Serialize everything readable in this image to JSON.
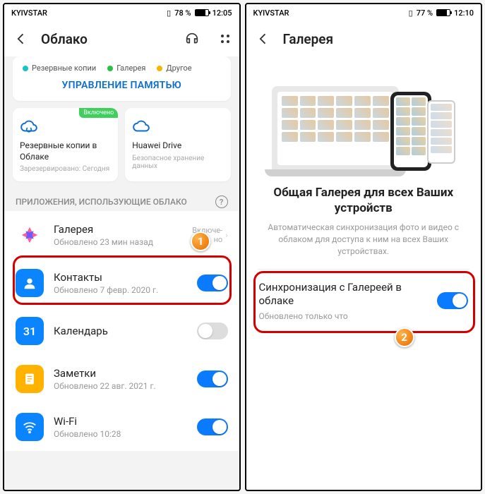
{
  "phone1": {
    "status": {
      "carrier": "KYIVSTAR",
      "battery": "78 %",
      "time": "12:05"
    },
    "header": {
      "title": "Облако"
    },
    "legend": {
      "item1": "Резервные копии",
      "item2": "Галерея",
      "item3": "Другое"
    },
    "memoryButton": "УПРАВЛЕНИЕ ПАМЯТЬЮ",
    "cards": {
      "backup": {
        "badge": "Включено",
        "title": "Резервные копии в Облаке",
        "sub": "Зарезервировано: Сегодня"
      },
      "drive": {
        "title": "Huawei Drive",
        "sub": "Безопасное хранение данных"
      }
    },
    "sectionTitle": "ПРИЛОЖЕНИЯ, ИСПОЛЬЗУЮЩИЕ ОБЛАКО",
    "apps": {
      "gallery": {
        "name": "Галерея",
        "sub": "Обновлено 23 мин назад",
        "status": "Включе-\nно"
      },
      "contacts": {
        "name": "Контакты",
        "sub": "Обновлено 7 февр. 2020 г."
      },
      "calendar": {
        "name": "Календарь",
        "sub": ""
      },
      "notes": {
        "name": "Заметки",
        "sub": "Обновлено 22 авг. 2021 г."
      },
      "wifi": {
        "name": "Wi-Fi",
        "sub": "Обновлено 10:28"
      }
    },
    "marker": "1"
  },
  "phone2": {
    "status": {
      "carrier": "KYIVSTAR",
      "battery": "77 %",
      "time": "12:10"
    },
    "header": {
      "title": "Галерея"
    },
    "hero": {
      "title": "Общая Галерея для всех Ваших устройств",
      "sub": "Автоматическая синхронизация фото и видео с облаком для доступа к ним на всех Ваших устройствах."
    },
    "sync": {
      "title": "Синхронизация с Галереей в облаке",
      "sub": "Обновлено только что"
    },
    "marker": "2",
    "colors": {
      "accent": "#0a7aff",
      "highlight": "#d40000"
    }
  }
}
